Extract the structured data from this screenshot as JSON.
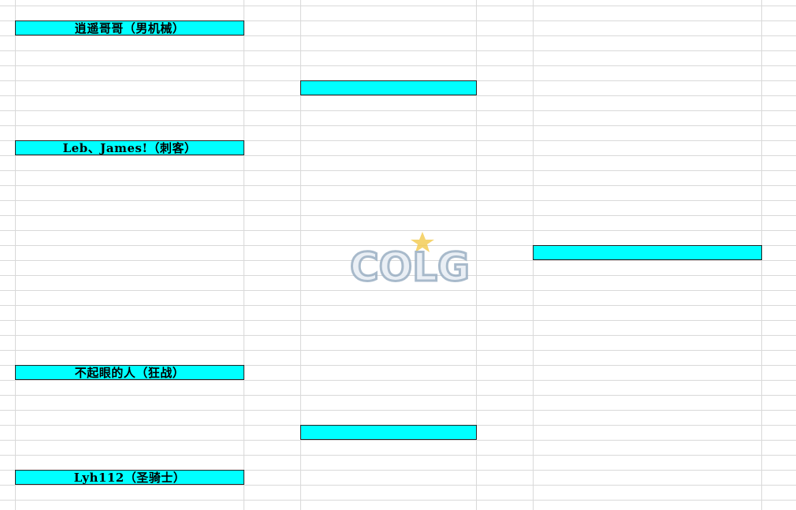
{
  "bracket": {
    "round1": [
      {
        "player": "逍遥哥哥（男机械）"
      },
      {
        "player": "Leb、James!（刺客）"
      },
      {
        "player": "不起眼的人（狂战）"
      },
      {
        "player": "Lyh112（圣骑士）"
      }
    ],
    "round2": [
      {
        "player": ""
      },
      {
        "player": ""
      }
    ],
    "final": [
      {
        "player": ""
      }
    ]
  },
  "watermark": {
    "text": "COLG",
    "icon": "star-icon"
  },
  "colors": {
    "cell_fill": "#00ffff",
    "gridline": "#d9d9d9"
  }
}
